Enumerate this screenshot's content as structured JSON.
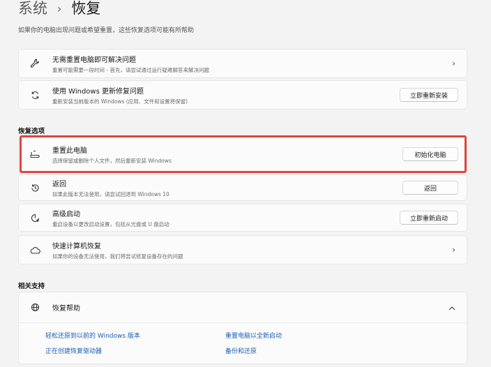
{
  "breadcrumb": {
    "parent": "系统",
    "separator": "›",
    "current": "恢复"
  },
  "subtitle": "如果你的电脑出现问题或希望重置，这些恢复选项可能有所帮助",
  "cards_top": [
    {
      "icon": "wrench-icon",
      "title": "无需重置电脑即可解决问题",
      "desc": "重置可能需要一段时间 - 首先，请尝试通过运行疑难解答来解决问题",
      "action": "chevron"
    },
    {
      "icon": "refresh-icon",
      "title": "使用 Windows 更新修复问题",
      "desc": "重新安装当前版本的 Windows (应用、文件和设置将保留)",
      "action_label": "立即重新安装"
    }
  ],
  "recovery_section_label": "恢复选项",
  "recovery_items": [
    {
      "icon": "reset-pc-icon",
      "title": "重置此电脑",
      "desc": "选择保留或删除个人文件，然后重新安装 Windows",
      "action_label": "初始化电脑"
    },
    {
      "icon": "history-icon",
      "title": "返回",
      "desc": "如果此版本无法使用，请尝试回退到 Windows 10",
      "action_label": "返回"
    },
    {
      "icon": "advanced-startup-icon",
      "title": "高级启动",
      "desc": "重启设备以更改启动设置，包括从光盘或 U 盘启动",
      "action_label": "立即重新启动"
    },
    {
      "icon": "cloud-icon",
      "title": "快速计算机恢复",
      "desc": "如果你的设备无法使用，我们将尝试修复设备存在的问题",
      "action": "chevron"
    }
  ],
  "related_section_label": "相关支持",
  "help": {
    "title": "恢复帮助",
    "links": [
      "轻松还原到以前的 Windows 版本",
      "重置电脑以全新启动",
      "正在创建恢复驱动器",
      "备份和还原"
    ]
  }
}
